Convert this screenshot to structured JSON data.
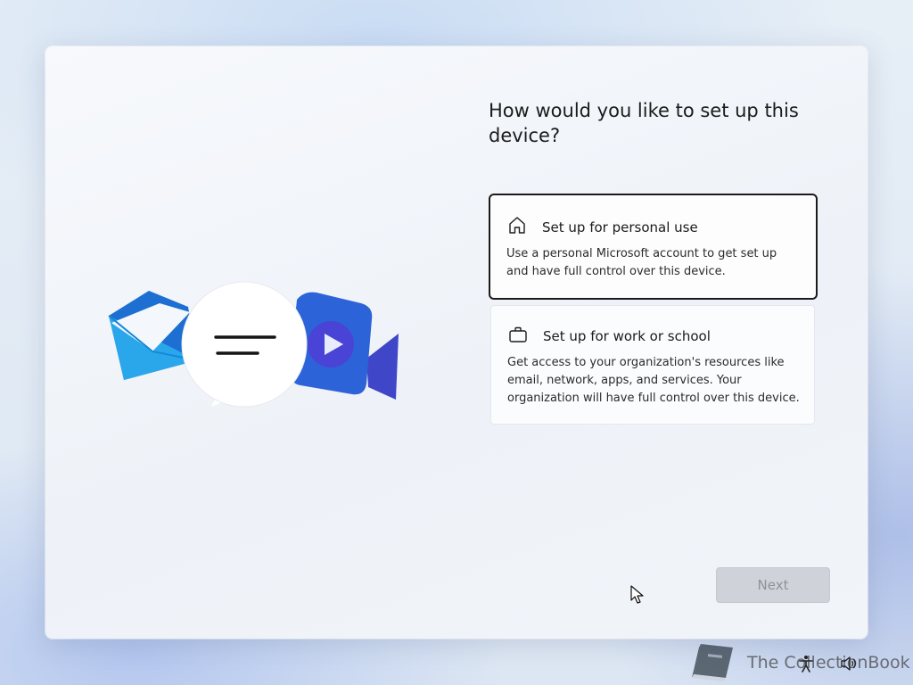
{
  "setup": {
    "title": "How would you like to set up this device?",
    "options": [
      {
        "icon": "home-icon",
        "title": "Set up for personal use",
        "description": "Use a personal Microsoft account to get set up and have full control over this device.",
        "selected": true
      },
      {
        "icon": "briefcase-icon",
        "title": "Set up for work or school",
        "description": "Get access to your organization's resources like email, network, apps, and services. Your organization will have full control over this device.",
        "selected": false
      }
    ],
    "next_label": "Next",
    "next_enabled": false
  },
  "illustration": {
    "icons": [
      "mail-icon",
      "chat-bubble-icon",
      "video-camera-icon"
    ]
  },
  "watermark": {
    "text": "The CollectionBook",
    "icon": "book-icon"
  },
  "tray": {
    "icons": [
      "accessibility-icon",
      "volume-icon"
    ]
  },
  "colors": {
    "accent_selected_border": "#1b1b1b",
    "button_disabled_bg": "#cfd3d9",
    "button_disabled_text": "#8e939a"
  }
}
